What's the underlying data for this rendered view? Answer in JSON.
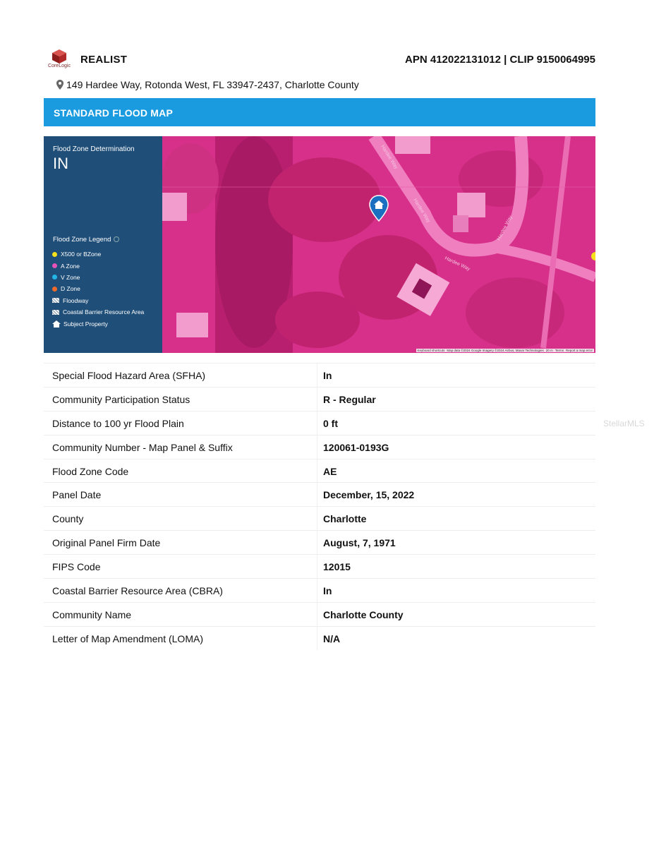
{
  "header": {
    "logo_text": "CoreLogic",
    "brand": "REALIST",
    "apn": "APN 412022131012 | CLIP 9150064995"
  },
  "address": "149 Hardee Way, Rotonda West, FL 33947-2437, Charlotte County",
  "banner_title": "STANDARD FLOOD MAP",
  "map": {
    "determination_label": "Flood Zone Determination",
    "determination_value": "IN",
    "legend_title": "Flood Zone Legend",
    "legend": [
      {
        "label": "X500 or BZone",
        "icon": "yellow-dot",
        "color": "#f5e11b"
      },
      {
        "label": "A Zone",
        "icon": "pink-dot",
        "color": "#e653b8"
      },
      {
        "label": "V Zone",
        "icon": "cyan-dot",
        "color": "#22b6e6"
      },
      {
        "label": "D Zone",
        "icon": "orange-dot",
        "color": "#f06b2a"
      },
      {
        "label": "Floodway",
        "icon": "hatch-icon"
      },
      {
        "label": "Coastal Barrier Resource Area",
        "icon": "hatch-icon"
      },
      {
        "label": "Subject Property",
        "icon": "house-icon"
      }
    ],
    "street_labels": [
      "Hardee Way",
      "Hardee Way",
      "Hardee Way",
      "Hardee Way"
    ],
    "attribution": [
      "Keyboard shortcuts",
      "Map data ©2024 Google Imagery ©2024 Airbus, Maxar Technologies",
      "20 m",
      "Terms",
      "Report a map error"
    ],
    "zone_color": "#e0348f",
    "panel_color": "#1f4e78"
  },
  "table": {
    "rows": [
      {
        "label": "Special Flood Hazard Area (SFHA)",
        "value": "In"
      },
      {
        "label": "Community Participation Status",
        "value": "R - Regular"
      },
      {
        "label": "Distance to 100 yr Flood Plain",
        "value": "0 ft"
      },
      {
        "label": "Community Number - Map Panel & Suffix",
        "value": "120061-0193G"
      },
      {
        "label": "Flood Zone Code",
        "value": "AE"
      },
      {
        "label": "Panel Date",
        "value": "December, 15, 2022"
      },
      {
        "label": "County",
        "value": "Charlotte"
      },
      {
        "label": "Original Panel Firm Date",
        "value": "August, 7, 1971"
      },
      {
        "label": "FIPS Code",
        "value": "12015"
      },
      {
        "label": "Coastal Barrier Resource Area (CBRA)",
        "value": "In"
      },
      {
        "label": "Community Name",
        "value": "Charlotte County"
      },
      {
        "label": "Letter of Map Amendment (LOMA)",
        "value": "N/A"
      }
    ]
  },
  "watermark": "StellarMLS"
}
